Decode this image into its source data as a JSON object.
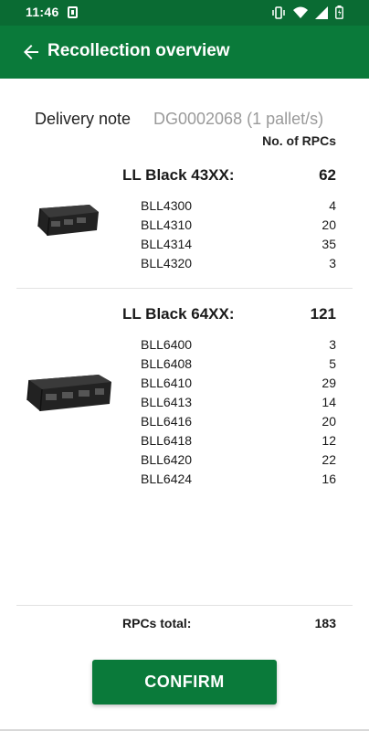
{
  "status_bar": {
    "time": "11:46"
  },
  "app_bar": {
    "title": "Recollection overview"
  },
  "delivery": {
    "label": "Delivery note",
    "value": "DG0002068 (1 pallet/s)",
    "column_header": "No. of RPCs"
  },
  "groups": [
    {
      "title": "LL Black 43XX:",
      "total": "62",
      "items": [
        {
          "code": "BLL4300",
          "qty": "4"
        },
        {
          "code": "BLL4310",
          "qty": "20"
        },
        {
          "code": "BLL4314",
          "qty": "35"
        },
        {
          "code": "BLL4320",
          "qty": "3"
        }
      ]
    },
    {
      "title": "LL Black 64XX:",
      "total": "121",
      "items": [
        {
          "code": "BLL6400",
          "qty": "3"
        },
        {
          "code": "BLL6408",
          "qty": "5"
        },
        {
          "code": "BLL6410",
          "qty": "29"
        },
        {
          "code": "BLL6413",
          "qty": "14"
        },
        {
          "code": "BLL6416",
          "qty": "20"
        },
        {
          "code": "BLL6418",
          "qty": "12"
        },
        {
          "code": "BLL6420",
          "qty": "22"
        },
        {
          "code": "BLL6424",
          "qty": "16"
        }
      ]
    }
  ],
  "summary": {
    "label": "RPCs total:",
    "value": "183"
  },
  "confirm_label": "CONFIRM",
  "colors": {
    "primary": "#0a7a3a",
    "status_bar": "#0a6b33",
    "muted_text": "#9a9a9a"
  },
  "icons": [
    "notification-icon",
    "vibrate-icon",
    "wifi-icon",
    "signal-icon",
    "battery-icon",
    "back-arrow-icon",
    "crate-image"
  ]
}
